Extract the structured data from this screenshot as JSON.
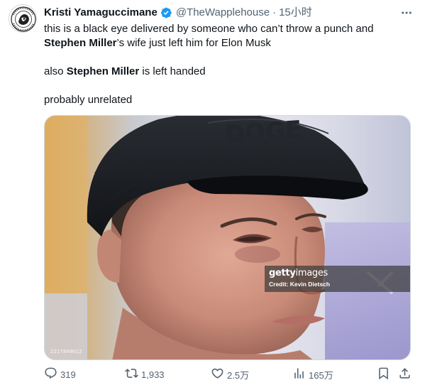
{
  "tweet": {
    "display_name": "Kristi Yamaguccimane",
    "handle": "@TheWapplehouse",
    "separator": "·",
    "time": "15小时",
    "lines": {
      "line1": "this is a black eye delivered by someone who can’t throw a punch and",
      "line2_bold": "Stephen Miller",
      "line2_rest": "’s wife just left him for Elon Musk",
      "line3_prefix": "also ",
      "line3_bold": "Stephen Miller",
      "line3_rest": " is left handed",
      "line4": "probably unrelated"
    },
    "photo": {
      "watermark_logo_bold": "getty",
      "watermark_logo_light": "images",
      "watermark_credit": "Credit: Kevin Dietsch",
      "image_id": "2217849012"
    }
  },
  "actions": {
    "reply_count": "319",
    "retweet_count": "1,933",
    "like_count": "2.5万",
    "view_count": "165万"
  },
  "icons": {
    "verified": "verified-badge-icon",
    "more": "more-horizontal-icon",
    "reply": "reply-icon",
    "retweet": "retweet-icon",
    "like": "heart-icon",
    "views": "analytics-icon",
    "bookmark": "bookmark-icon",
    "share": "share-icon"
  },
  "colors": {
    "verified_blue": "#1d9bf0",
    "secondary_text": "#536471",
    "primary_text": "#0f1419"
  }
}
